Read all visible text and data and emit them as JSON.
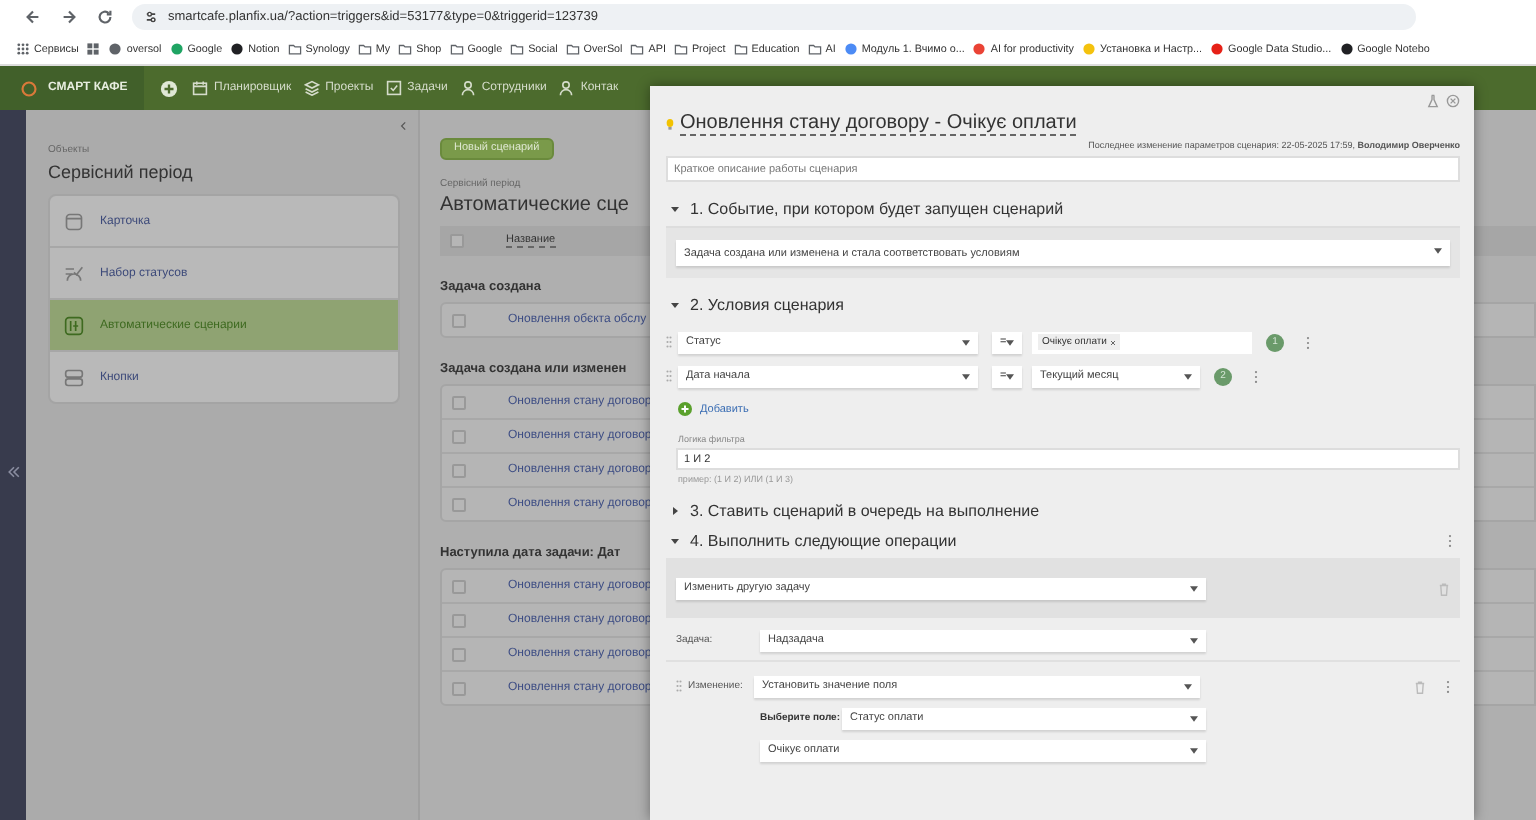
{
  "browser": {
    "url": "smartcafe.planfix.ua/?action=triggers&id=53177&type=0&triggerid=123739",
    "bookmarks": [
      {
        "label": "Сервисы",
        "kind": "apps"
      },
      {
        "kind": "grid"
      },
      {
        "label": "oversol",
        "kind": "site",
        "color": "#5f6368"
      },
      {
        "label": "Google",
        "kind": "site",
        "color": "#1fa463"
      },
      {
        "label": "Notion",
        "kind": "site",
        "color": "#202124"
      },
      {
        "label": "Synology",
        "kind": "folder"
      },
      {
        "label": "My",
        "kind": "folder"
      },
      {
        "label": "Shop",
        "kind": "folder"
      },
      {
        "label": "Google",
        "kind": "folder"
      },
      {
        "label": "Social",
        "kind": "folder"
      },
      {
        "label": "OverSol",
        "kind": "folder"
      },
      {
        "label": "API",
        "kind": "folder"
      },
      {
        "label": "Project",
        "kind": "folder"
      },
      {
        "label": "Education",
        "kind": "folder"
      },
      {
        "label": "AI",
        "kind": "folder"
      },
      {
        "label": "Модуль 1. Вчимо о...",
        "kind": "site",
        "color": "#4c8bf5"
      },
      {
        "label": "AI for productivity",
        "kind": "site",
        "color": "#ea4335"
      },
      {
        "label": "Установка и Настр...",
        "kind": "site",
        "color": "#f4c20d"
      },
      {
        "label": "Google Data Studio...",
        "kind": "site",
        "color": "#e62117"
      },
      {
        "label": "Google Notebo",
        "kind": "site",
        "color": "#202124"
      }
    ]
  },
  "app_nav": {
    "logo": "СМАРТ КАФЕ",
    "items": [
      {
        "label": "Планировщик",
        "kind": "calendar"
      },
      {
        "label": "Проекты",
        "kind": "stack"
      },
      {
        "label": "Задачи",
        "kind": "check"
      },
      {
        "label": "Сотрудники",
        "kind": "person"
      },
      {
        "label": "Контак",
        "kind": "person"
      }
    ]
  },
  "sidebar": {
    "caption": "Объекты",
    "title": "Сервісний період",
    "items": [
      {
        "label": "Карточка",
        "kind": "card",
        "selected": false
      },
      {
        "label": "Набор статусов",
        "kind": "statuses",
        "selected": false
      },
      {
        "label": "Автоматические сценарии",
        "kind": "scenario",
        "selected": true
      },
      {
        "label": "Кнопки",
        "kind": "buttons",
        "selected": false
      }
    ]
  },
  "content": {
    "new_button": "Новый сценарий",
    "breadcrumb": "Сервісний період",
    "title": "Автоматические сце",
    "table": {
      "column": "Название",
      "all_checked": false,
      "groups": [
        {
          "title": "Задача создана",
          "rows": [
            {
              "name": "Оновлення обєкта обслу",
              "checked": false
            }
          ]
        },
        {
          "title": "Задача создана или изменен",
          "rows": [
            {
              "name": "Оновлення стану договор",
              "checked": false
            },
            {
              "name": "Оновлення стану договор",
              "checked": false
            },
            {
              "name": "Оновлення стану договор",
              "checked": false
            },
            {
              "name": "Оновлення стану договор",
              "checked": false
            }
          ]
        },
        {
          "title": "Наступила дата задачи: Дат",
          "rows": [
            {
              "name": "Оновлення стану договор",
              "checked": false
            },
            {
              "name": "Оновлення стану договор",
              "checked": false
            },
            {
              "name": "Оновлення стану договор",
              "checked": false
            },
            {
              "name": "Оновлення стану договор",
              "checked": false
            }
          ]
        }
      ]
    }
  },
  "dialog": {
    "title": "Оновлення стану договору - Очікує оплати",
    "last_change": "Последнее изменение параметров сценария: 22-05-2025 17:59, **Володимир Оверченко**",
    "description": {
      "placeholder": "Краткое описание работы сценария"
    },
    "event_section": {
      "title": "1. Событие, при котором будет запущен сценарий",
      "expanded": true,
      "event": "Задача создана или изменена и стала соответствовать условиям"
    },
    "conditions_section": {
      "title": "2. Условия сценария",
      "expanded": true,
      "conditions": [
        {
          "field": "Статус",
          "operator": "=",
          "kind": "tags",
          "values": [
            "Очікує оплати"
          ],
          "number": "1"
        },
        {
          "field": "Дата начала",
          "operator": "=",
          "kind": "select",
          "values": [
            "Текущий месяц"
          ],
          "number": "2"
        }
      ],
      "add_button": "Добавить",
      "logic_label": "Логика фильтра",
      "logic_value": "1 И 2",
      "logic_hint": "пример: (1 И 2) ИЛИ (1 И 3)"
    },
    "queue_section": {
      "title": "3. Ставить сценарий в очередь на выполнение",
      "expanded": false
    },
    "operations_section": {
      "title": "4. Выполнить следующие операции",
      "expanded": true,
      "action": "Изменить другую задачу",
      "task_label": "Задача:",
      "task": "Надзадача",
      "change_label": "Изменение:",
      "change": "Установить значение поля",
      "field_label": "Выберите поле:",
      "field": "Статус оплати",
      "value": "Очікує оплати"
    }
  }
}
